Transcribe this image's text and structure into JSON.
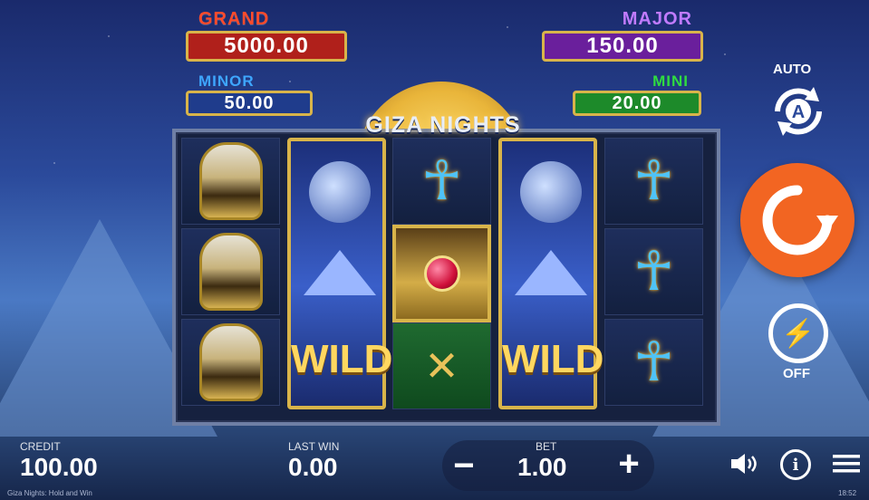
{
  "game": {
    "logo_text": "GIZA NIGHTS",
    "footer_text": "Giza Nights: Hold and Win",
    "clock": "18:52"
  },
  "jackpots": {
    "grand": {
      "name": "GRAND",
      "value": "5000.00",
      "name_color": "#ff4b2b",
      "plate_color": "#b0201b"
    },
    "minor": {
      "name": "MINOR",
      "value": "50.00",
      "name_color": "#3ea6ff",
      "plate_color": "#1f3c8c"
    },
    "major": {
      "name": "MAJOR",
      "value": "150.00",
      "name_color": "#c07bff",
      "plate_color": "#6a1f9c"
    },
    "mini": {
      "name": "MINI",
      "value": "20.00",
      "name_color": "#2fdc40",
      "plate_color": "#1d8a2a"
    }
  },
  "reels": {
    "reel1": [
      "falcon",
      "falcon",
      "falcon"
    ],
    "reel2": [
      "wild"
    ],
    "reel3": [
      "ankh",
      "scarab",
      "spears"
    ],
    "reel4": [
      "wild"
    ],
    "reel5": [
      "ankh",
      "ankh",
      "ankh"
    ],
    "wild_label": "WILD"
  },
  "controls": {
    "auto_label": "AUTO",
    "auto_letter": "A",
    "turbo_label": "OFF",
    "spin_color": "#f26522",
    "icons": [
      "autoplay-icon",
      "spin-icon",
      "turbo-icon",
      "sound-icon",
      "info-icon",
      "menu-icon",
      "minus-icon",
      "plus-icon"
    ]
  },
  "bottom_bar": {
    "credit_label": "CREDIT",
    "credit_value": "100.00",
    "last_win_label": "LAST WIN",
    "last_win_value": "0.00",
    "bet_label": "BET",
    "bet_value": "1.00",
    "minus_symbol": "−",
    "plus_symbol": "+"
  }
}
